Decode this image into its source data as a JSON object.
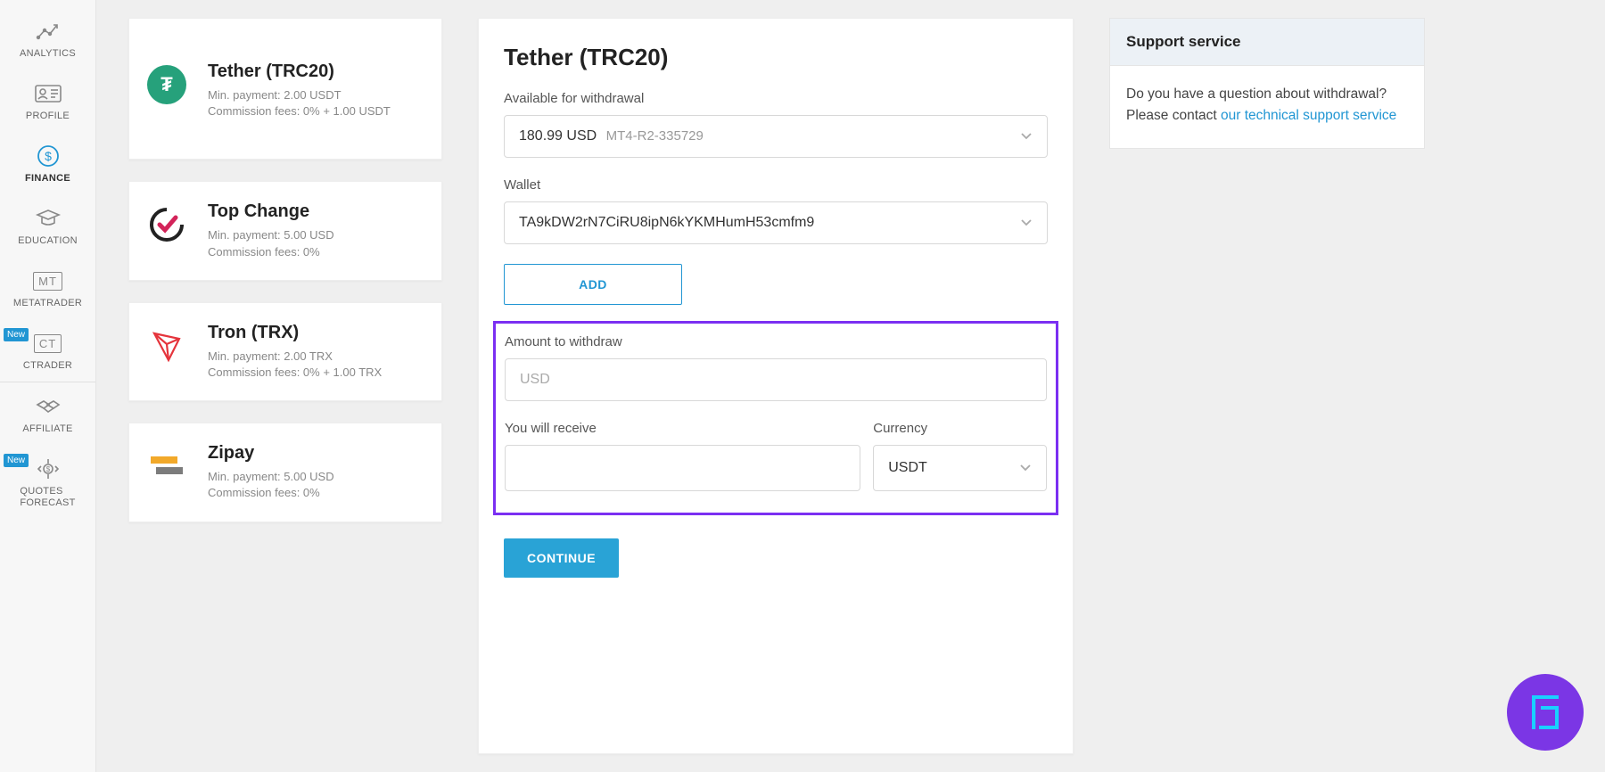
{
  "sidebar": {
    "items": [
      {
        "label": "ANALYTICS",
        "icon": "analytics-icon"
      },
      {
        "label": "PROFILE",
        "icon": "profile-icon"
      },
      {
        "label": "FINANCE",
        "icon": "finance-icon"
      },
      {
        "label": "EDUCATION",
        "icon": "education-icon"
      },
      {
        "label": "METATRADER",
        "icon": "mt-icon",
        "badge": ""
      },
      {
        "label": "CTRADER",
        "icon": "ct-icon",
        "badge": "New"
      },
      {
        "label": "AFFILIATE",
        "icon": "affiliate-icon"
      },
      {
        "label": "QUOTES FORECAST",
        "icon": "quotes-icon",
        "badge": "New",
        "label2": "FORECAST"
      }
    ],
    "mt_text": "MT",
    "ct_text": "CT",
    "quotes_label1": "QUOTES",
    "quotes_label2": "FORECAST"
  },
  "methods": [
    {
      "title": "Tether (TRC20)",
      "min_line": "Min. payment: 2.00 USDT",
      "fee_line": "Commission fees: 0% + 1.00 USDT",
      "icon": "tether-icon",
      "icon_char": "₮"
    },
    {
      "title": "Top Change",
      "min_line": "Min. payment: 5.00 USD",
      "fee_line": "Commission fees: 0%",
      "icon": "topchange-icon"
    },
    {
      "title": "Tron (TRX)",
      "min_line": "Min. payment: 2.00 TRX",
      "fee_line": "Commission fees: 0% + 1.00 TRX",
      "icon": "tron-icon"
    },
    {
      "title": "Zipay",
      "min_line": "Min. payment: 5.00 USD",
      "fee_line": "Commission fees: 0%",
      "icon": "zipay-icon"
    }
  ],
  "form": {
    "title": "Tether (TRC20)",
    "available_label": "Available for withdrawal",
    "account_balance": "180.99 USD",
    "account_id": "MT4-R2-335729",
    "wallet_label": "Wallet",
    "wallet_value": "TA9kDW2rN7CiRU8ipN6kYKMHumH53cmfm9",
    "add_label": "ADD",
    "amount_label": "Amount to withdraw",
    "amount_placeholder": "USD",
    "receive_label": "You will receive",
    "currency_label": "Currency",
    "currency_value": "USDT",
    "continue_label": "CONTINUE"
  },
  "support": {
    "title": "Support service",
    "body_prefix": "Do you have a question about withdrawal? Please contact ",
    "link_text": "our technical support service"
  }
}
